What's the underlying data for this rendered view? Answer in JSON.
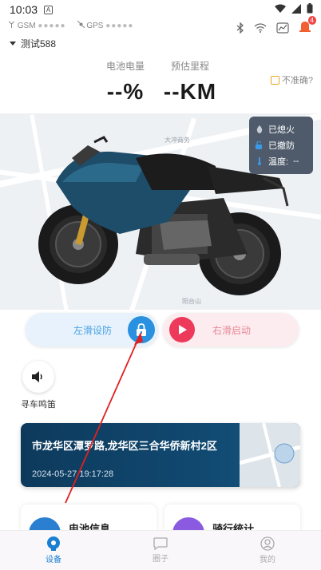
{
  "status_bar": {
    "time": "10:03",
    "notification": "A"
  },
  "signals": {
    "gsm_label": "GSM",
    "gsm_value": "●●●●●",
    "gps_label": "GPS",
    "gps_value": "●●●●●"
  },
  "header": {
    "warning_count": "4"
  },
  "device": {
    "name": "测试588"
  },
  "battery": {
    "label": "电池电量",
    "value": "--%"
  },
  "range": {
    "label": "预估里程",
    "value": "--KM"
  },
  "inaccurate_label": "不准确?",
  "vehicle_status": {
    "ignition": "已熄火",
    "defense": "已撤防",
    "temperature_label": "温度:",
    "temperature_value": "--"
  },
  "map_labels": {
    "a": "大冲商务",
    "b": "大冲",
    "c": "阳台山"
  },
  "slider_left": {
    "label": "左滑设防"
  },
  "slider_right": {
    "label": "右滑启动"
  },
  "horn": {
    "label": "寻车鸣笛"
  },
  "location": {
    "address": "市龙华区潭罗路,龙华区三合华侨新村2区",
    "time": "2024-05-27 19:17:28"
  },
  "cards": [
    {
      "title": "电池信息"
    },
    {
      "title": "骑行统计"
    }
  ],
  "nav": [
    {
      "label": "设备"
    },
    {
      "label": "圈子"
    },
    {
      "label": "我的"
    }
  ],
  "colors": {
    "accent": "#2a90e0",
    "start": "#ee3a5a",
    "card_bg": "#0d3a5c"
  }
}
